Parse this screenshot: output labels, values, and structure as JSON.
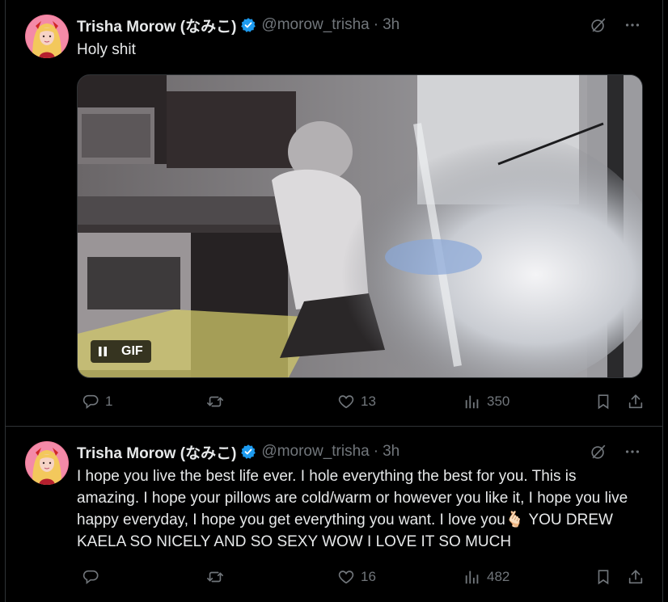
{
  "tweets": [
    {
      "author_name": "Trisha Morow (なみこ)",
      "handle": "@morow_trisha",
      "separator": "·",
      "time": "3h",
      "text": "Holy shit",
      "media": {
        "type": "gif",
        "badge_label": "GIF"
      },
      "stats": {
        "replies": "1",
        "retweets": "",
        "likes": "13",
        "views": "350"
      }
    },
    {
      "author_name": "Trisha Morow (なみこ)",
      "handle": "@morow_trisha",
      "separator": "·",
      "time": "3h",
      "text": "I hope you live the best life ever. I hole everything the best for you. This is amazing. I hope your pillows are cold/warm or however you like it, I hope you live happy everyday, I hope you get everything you want. I love you🫰🏻 YOU DREW KAELA SO NICELY AND SO SEXY WOW I LOVE IT SO MUCH",
      "stats": {
        "replies": "",
        "retweets": "",
        "likes": "16",
        "views": "482"
      }
    }
  ],
  "colors": {
    "background": "#000000",
    "text_primary": "#e7e9ea",
    "text_secondary": "#71767b",
    "verified_badge": "#1d9bf0",
    "divider": "#2f3336"
  },
  "icons": [
    "grok-icon",
    "more-icon",
    "reply-icon",
    "retweet-icon",
    "like-icon",
    "views-icon",
    "bookmark-icon",
    "share-icon",
    "verified-icon",
    "pause-icon"
  ]
}
